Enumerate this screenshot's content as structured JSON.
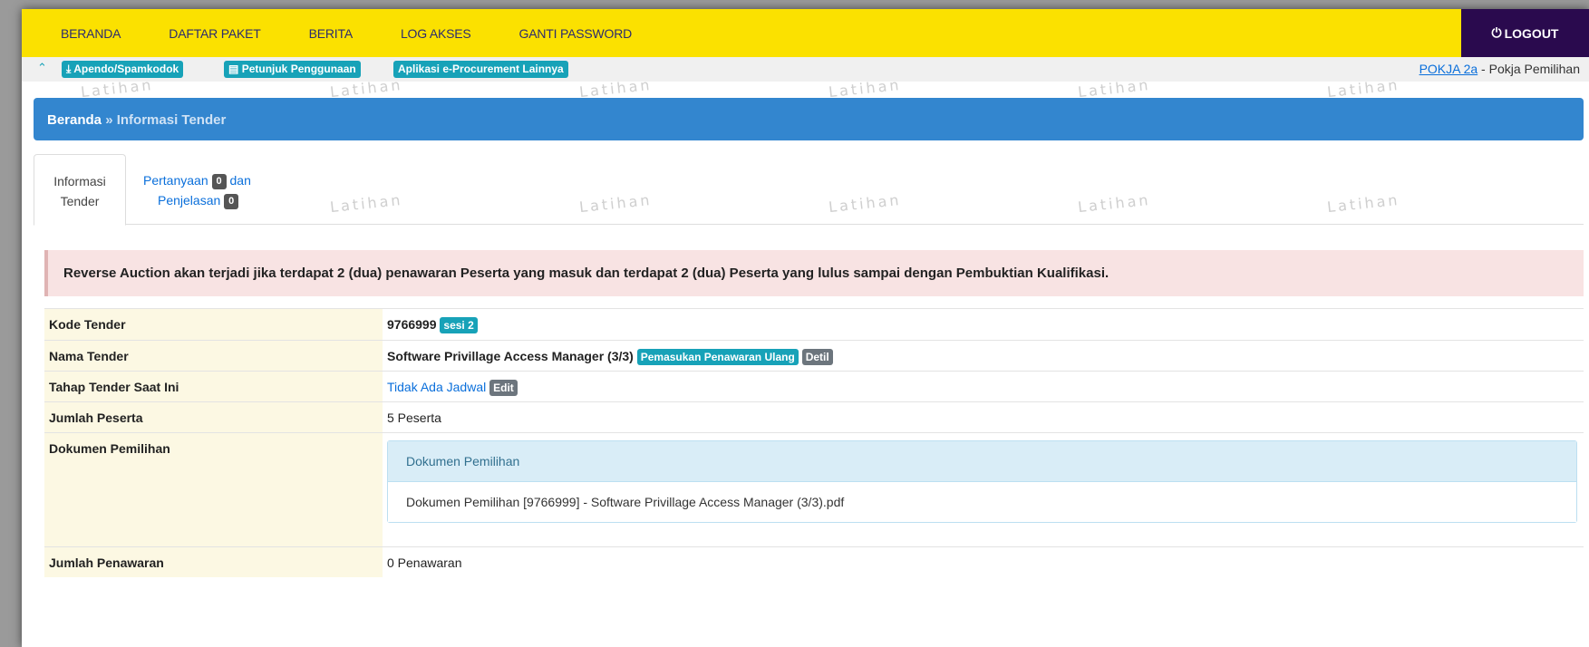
{
  "topnav": {
    "items": [
      "BERANDA",
      "DAFTAR PAKET",
      "BERITA",
      "LOG AKSES",
      "GANTI PASSWORD"
    ],
    "logout_label": "LOGOUT"
  },
  "subbar": {
    "buttons": [
      "Apendo/Spamkodok",
      "Petunjuk Penggunaan",
      "Aplikasi e-Procurement Lainnya"
    ],
    "user_link": "POKJA 2a",
    "user_role": " - Pokja Pemilihan"
  },
  "watermark": "Latihan",
  "breadcrumb": {
    "home": "Beranda",
    "separator": " » ",
    "current": "Informasi Tender"
  },
  "tabs": {
    "active_line1": "Informasi",
    "active_line2": "Tender",
    "link_line1": "Pertanyaan",
    "link_count1": "0",
    "link_and": "dan",
    "link_line2": "Penjelasan",
    "link_count2": "0"
  },
  "alert": "Reverse Auction akan terjadi jika terdapat 2 (dua) penawaran Peserta yang masuk dan terdapat 2 (dua) Peserta yang lulus sampai dengan Pembuktian Kualifikasi.",
  "table": {
    "kode_label": "Kode Tender",
    "kode_value": "9766999",
    "kode_badge": "sesi 2",
    "nama_label": "Nama Tender",
    "nama_value": "Software Privillage Access Manager (3/3)",
    "nama_badge": "Pemasukan Penawaran Ulang",
    "nama_detil": "Detil",
    "tahap_label": "Tahap Tender Saat Ini",
    "tahap_value": "Tidak Ada Jadwal",
    "tahap_edit": "Edit",
    "peserta_label": "Jumlah Peserta",
    "peserta_value": "5 Peserta",
    "dokumen_label": "Dokumen Pemilihan",
    "dokumen_panel_title": "Dokumen Pemilihan",
    "dokumen_file": "Dokumen Pemilihan [9766999] - Software Privillage Access Manager (3/3).pdf",
    "penawaran_label": "Jumlah Penawaran",
    "penawaran_value": "0 Penawaran"
  }
}
